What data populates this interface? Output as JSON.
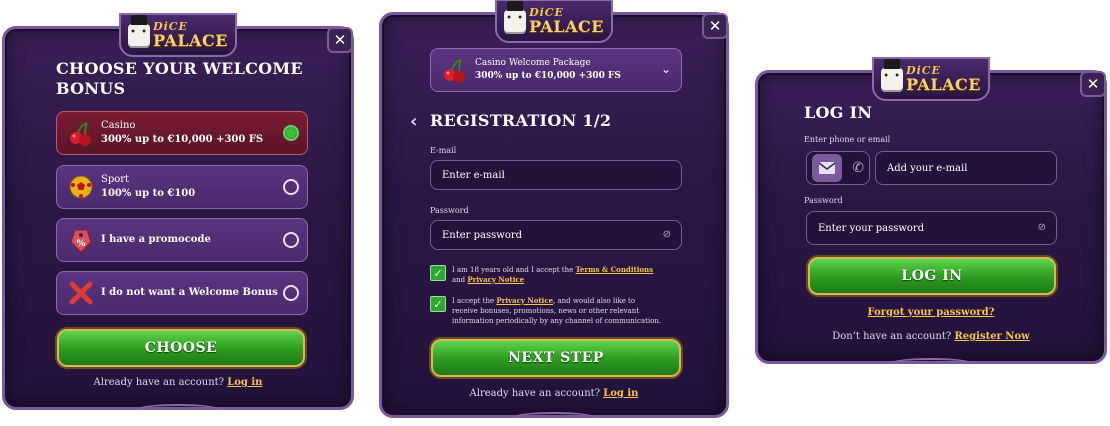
{
  "brand": {
    "top": "DiCE",
    "bottom": "PALACE"
  },
  "close_glyph": "✕",
  "welcome": {
    "title": "CHOOSE YOUR WELCOME BONUS",
    "options": [
      {
        "label": "Casino",
        "sub": "300% up to €10,000 +300 FS",
        "icon": "cherries-icon",
        "selected": true
      },
      {
        "label": "Sport",
        "sub": "100% up to €100",
        "icon": "soccer-ball-icon",
        "selected": false
      },
      {
        "label": "I have a promocode",
        "sub": "",
        "icon": "promo-tag-icon",
        "selected": false
      },
      {
        "label": "I do not want a Welcome Bonus",
        "sub": "",
        "icon": "red-cross-icon",
        "selected": false
      }
    ],
    "choose_label": "CHOOSE",
    "account_text": "Already have an account?",
    "login_link": "Log in"
  },
  "registration": {
    "package_name": "Casino Welcome Package",
    "package_offer": "300% up to €10,000 +300 FS",
    "title": "REGISTRATION 1/2",
    "email_label": "E-mail",
    "email_placeholder": "Enter e-mail",
    "password_label": "Password",
    "password_placeholder": "Enter password",
    "terms_prefix": "I am 18 years old and I accept the",
    "terms_link": "Terms & Conditions",
    "terms_and": "and",
    "privacy_link": "Privacy Notice",
    "privacy_prefix": "I accept the",
    "privacy_link2": "Privacy Notice",
    "privacy_suffix": ", and would also like to receive bonuses, promotions, news or other relevant information periodically by any channel of communication.",
    "next_label": "NEXT STEP",
    "account_text": "Already have an account?",
    "login_link": "Log in"
  },
  "login": {
    "title": "LOG IN",
    "contact_label": "Enter phone or email",
    "email_placeholder": "Add your e-mail",
    "password_label": "Password",
    "password_placeholder": "Enter your password",
    "login_label": "LOG IN",
    "forgot_link": "Forgot your password?",
    "no_account_text": "Don’t have an account?",
    "register_link": "Register Now"
  },
  "colors": {
    "modal_bg": "#2b1744",
    "accent_gold": "#f6c64a",
    "button_green": "#2f9e22",
    "selected_red": "#7a1c33"
  }
}
